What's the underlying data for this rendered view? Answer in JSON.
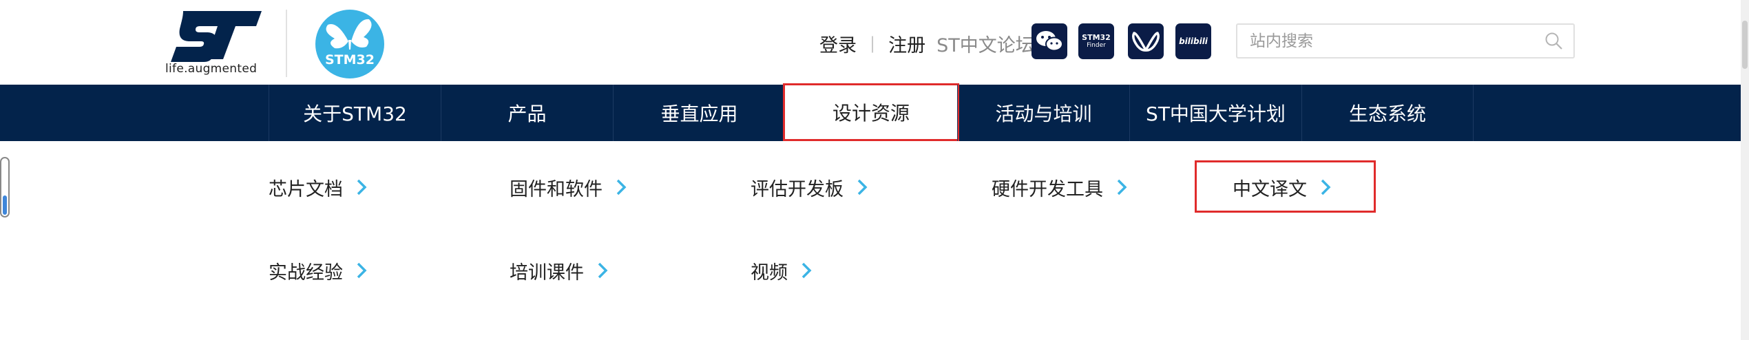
{
  "brand": {
    "tagline": "life.augmented",
    "stm32_badge": "STM32"
  },
  "top_links": {
    "login": "登录",
    "register": "注册",
    "separator": "|",
    "forum": "ST中文论坛"
  },
  "social": {
    "wechat_icon": "wechat-icon",
    "finder_line1": "STM32",
    "finder_line2": "Finder",
    "weibo_icon": "butterfly-icon",
    "bilibili": "bilibili"
  },
  "search": {
    "placeholder": "站内搜索",
    "value": ""
  },
  "nav": {
    "items": [
      {
        "label": "关于STM32"
      },
      {
        "label": "产品"
      },
      {
        "label": "垂直应用"
      },
      {
        "label": "设计资源"
      },
      {
        "label": "活动与培训"
      },
      {
        "label": "ST中国大学计划"
      },
      {
        "label": "生态系统"
      }
    ],
    "active_index": 3
  },
  "submenu": {
    "items": [
      {
        "label": "芯片文档"
      },
      {
        "label": "固件和软件"
      },
      {
        "label": "评估开发板"
      },
      {
        "label": "硬件开发工具"
      },
      {
        "label": "中文译文"
      },
      {
        "label": "实战经验"
      },
      {
        "label": "培训课件"
      },
      {
        "label": "视频"
      }
    ]
  },
  "colors": {
    "nav_bg": "#03234b",
    "accent_blue": "#3bb4e5",
    "highlight_red": "#e02b2b"
  }
}
